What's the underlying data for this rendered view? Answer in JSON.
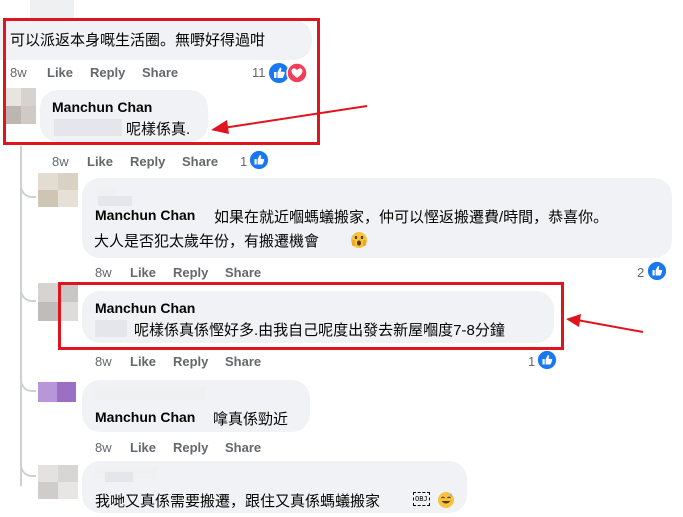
{
  "comments": [
    {
      "text": "可以派返本身嘅生活圈。無嘢好得過咁",
      "time": "8w",
      "like": "Like",
      "reply": "Reply",
      "share": "Share",
      "reaction_count": "11"
    },
    {
      "author": "Manchun Chan",
      "text": "呢樣係真.",
      "time": "8w",
      "like": "Like",
      "reply": "Reply",
      "share": "Share",
      "reaction_count": "1"
    },
    {
      "author": "Manchun Chan",
      "text": "如果在就近嗰螞蟻搬家，仲可以慳返搬遷費/時間，恭喜你。",
      "text2": "大人是否犯太歲年份，有搬遷機會",
      "time": "8w",
      "like": "Like",
      "reply": "Reply",
      "share": "Share",
      "reaction_count": "2"
    },
    {
      "author": "Manchun Chan",
      "text": "呢樣係真係慳好多.由我自己呢度出發去新屋嗰度7-8分鐘",
      "time": "8w",
      "like": "Like",
      "reply": "Reply",
      "share": "Share",
      "reaction_count": "1"
    },
    {
      "author": "Manchun Chan",
      "text": "嗱真係勁近",
      "time": "8w",
      "like": "Like",
      "reply": "Reply",
      "share": "Share"
    },
    {
      "text": "我哋又真係需要搬遷，跟住又真係螞蟻搬家",
      "obj_badge": "OBJ"
    }
  ],
  "colors": {
    "highlight_box": "#e0141e",
    "arrow": "#e0141e",
    "like_blue": "#1877f2",
    "love_red": "#f33e58"
  },
  "icons": [
    "like-reaction-icon",
    "love-reaction-icon",
    "surprised-emoji-icon",
    "grinning-sweat-emoji-icon",
    "red-arrow-icon"
  ]
}
